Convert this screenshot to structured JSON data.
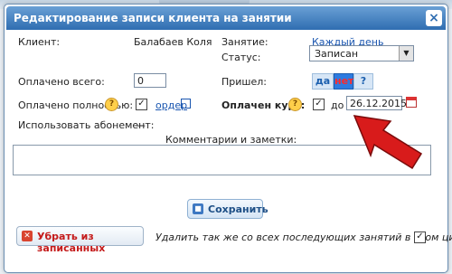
{
  "dialog": {
    "title": "Редактирование записи клиента на занятии",
    "close_label": "×"
  },
  "form": {
    "client_label": "Клиент:",
    "client_value": "Балабаев Коля",
    "lesson_label": "Занятие:",
    "lesson_value": "Каждый день",
    "status_label": "Статус:",
    "status_value": "Записан",
    "paid_total_label": "Оплачено всего:",
    "paid_total_value": "0",
    "came_label": "Пришел:",
    "came_options": [
      "да",
      "нет",
      "?"
    ],
    "came_selected": "нет",
    "paid_full_label": "Оплачено полностью:",
    "paid_full_checked": true,
    "order_link": "ордер",
    "course_paid_label": "Оплачен курс:",
    "course_paid_checked": true,
    "until_label": "до",
    "until_date": "26.12.2015",
    "subscription_label": "Использовать абонемент:",
    "subscription_value": "—",
    "notes_label": "Комментарии и заметки:",
    "notes_value": "",
    "help_icon_text": "?"
  },
  "actions": {
    "save_label": "Сохранить",
    "remove_label": "Убрать из записанных",
    "remove_all_label": "Удалить так же со всех последующих занятий в этом цикле",
    "remove_all_checked": true
  },
  "colors": {
    "titlebar": "#2f6db1",
    "selected_segment": "#2d7be0",
    "arrow": "#d81b1b"
  }
}
